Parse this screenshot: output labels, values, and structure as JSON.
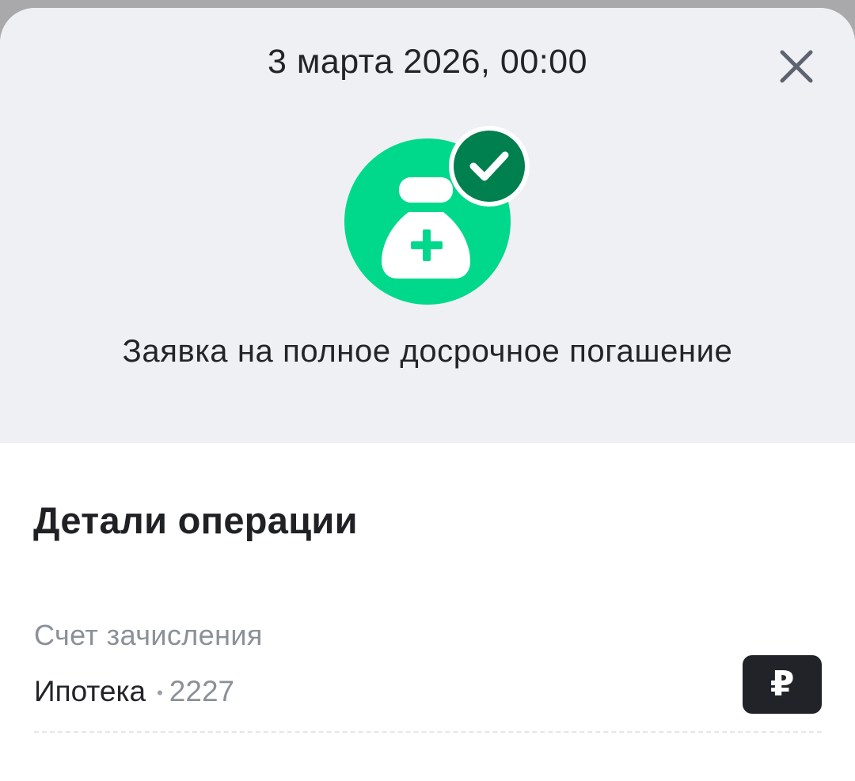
{
  "header": {
    "date": "3 марта 2026, 00:00",
    "title": "Заявка на полное досрочное погашение"
  },
  "details": {
    "section_title": "Детали операции",
    "account_label": "Счет зачисления",
    "account_name": "Ипотека",
    "account_separator": "•",
    "account_number": "2227",
    "currency_symbol": "₽"
  },
  "icons": {
    "close": "close-icon",
    "operation": "money-bag-plus-icon",
    "status": "check-badge-icon"
  },
  "colors": {
    "header_bg": "#eff0f4",
    "icon_green": "#00d98b",
    "check_green": "#007f4f",
    "badge_dark": "#212329"
  }
}
